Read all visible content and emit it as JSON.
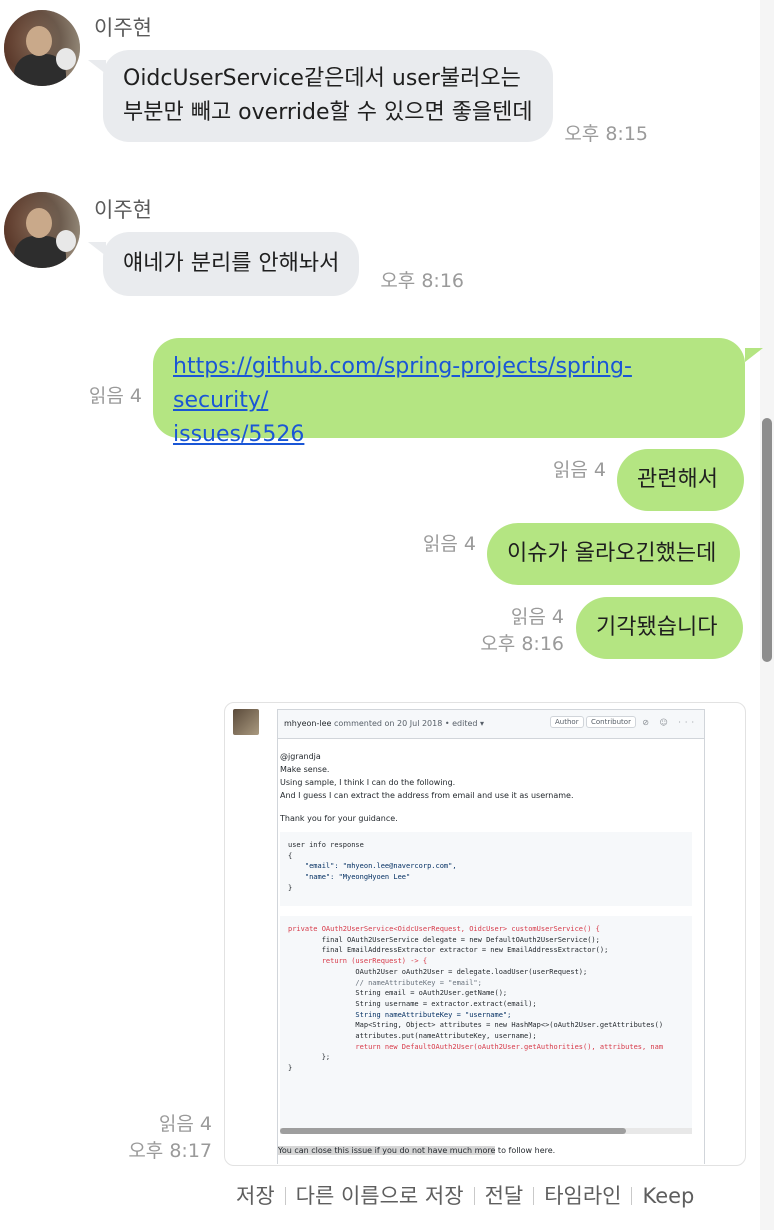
{
  "messages": [
    {
      "sender": "이주현",
      "lines": [
        "OidcUserService같은데서 user불러오는",
        "부분만 빼고 override할 수 있으면 좋을텐데"
      ],
      "time": "오후 8:15"
    },
    {
      "sender": "이주현",
      "text": "얘네가 분리를 안해놔서",
      "time": "오후 8:16"
    }
  ],
  "mine": [
    {
      "link_lines": [
        "https://github.com/spring-projects/spring-security/",
        "issues/5526"
      ],
      "read": "읽음 4"
    },
    {
      "text": "관련해서",
      "read": "읽음 4"
    },
    {
      "text": "이슈가 올라오긴했는데",
      "read": "읽음 4"
    },
    {
      "text": "기각됐습니다",
      "read": "읽음 4",
      "time": "오후 8:16"
    }
  ],
  "image_message": {
    "read": "읽음 4",
    "time": "오후 8:17",
    "header": {
      "author": "mhyeon-lee",
      "rest": " commented on 20 Jul 2018 • edited ▾",
      "badge1": "Author",
      "badge2": "Contributor",
      "icons": "⊘ ☺ ···"
    },
    "body_lines": [
      "@jgrandja",
      "Make sense.",
      "Using sample, I think I can do the following.",
      "And I guess I can extract the address from email and use it as username.",
      "Thank you for your guidance."
    ],
    "code1": [
      "user info response",
      "{",
      "    \"email\": \"mhyeon.lee@navercorp.com\",",
      "    \"name\": \"MyeongHyoen Lee\"",
      "}"
    ],
    "code2": [
      "private OAuth2UserService<OidcUserRequest, OidcUser> customUserService() {",
      "        final OAuth2UserService delegate = new DefaultOAuth2UserService();",
      "        final EmailAddressExtractor extractor = new EmailAddressExtractor();",
      "",
      "        return (userRequest) -> {",
      "                OAuth2User oAuth2User = delegate.loadUser(userRequest);",
      "",
      "                // nameAttributeKey = \"email\";",
      "                String email = oAuth2User.getName();",
      "                String username = extractor.extract(email);",
      "",
      "                String nameAttributeKey = \"username\";",
      "                Map<String, Object> attributes = new HashMap<>(oAuth2User.getAttributes()",
      "                attributes.put(nameAttributeKey, username);",
      "",
      "                return new DefaultOAuth2User(oAuth2User.getAuthorities(), attributes, nam",
      "        };",
      "}"
    ],
    "footer_highlight": "You can close this issue if you do not have much more",
    "footer_rest": " to follow here."
  },
  "actions": [
    "저장",
    "다른 이름으로 저장",
    "전달",
    "타임라인",
    "Keep"
  ]
}
